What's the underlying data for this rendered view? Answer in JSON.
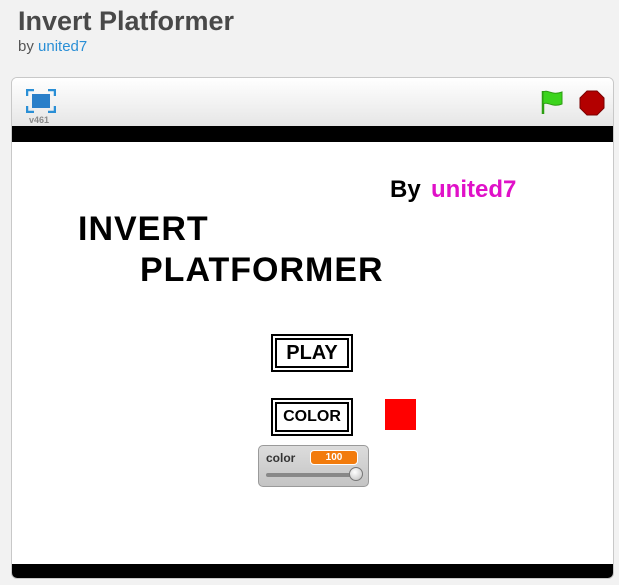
{
  "header": {
    "title": "Invert Platformer",
    "by_label": "by",
    "author": "united7"
  },
  "player": {
    "version": "v461",
    "icons": {
      "fullscreen": "fullscreen-icon",
      "green_flag": "green-flag-icon",
      "stop": "stop-sign-icon"
    },
    "colors": {
      "flag": "#3bd41c",
      "stop": "#b30000",
      "fullscreen": "#2a8fd6"
    }
  },
  "stage": {
    "by_label": "By",
    "author": "united7",
    "author_color": "#e010c8",
    "title_line1": "INVERT",
    "title_line2": "PLATFORMER",
    "play_button": "PLAY",
    "color_button": "COLOR",
    "swatch_color": "#ff0000",
    "variable_monitor": {
      "name": "color",
      "value": "100",
      "slider_level": 1.0
    }
  }
}
